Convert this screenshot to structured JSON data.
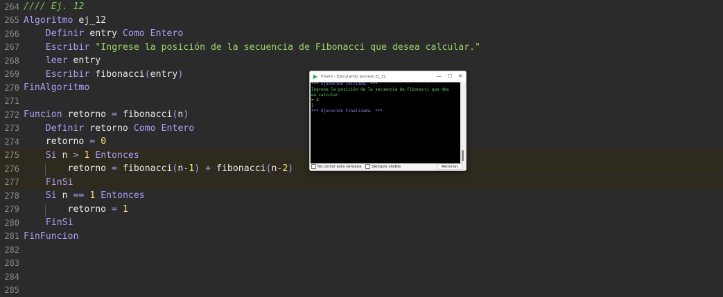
{
  "editor": {
    "lines": [
      {
        "no": "264",
        "tokens": [
          {
            "c": "cm",
            "t": "//// Ej. 12"
          }
        ]
      },
      {
        "no": "265",
        "tokens": [
          {
            "c": "kw",
            "t": "Algoritmo"
          },
          {
            "c": "tx",
            "t": " ej_12"
          }
        ]
      },
      {
        "no": "266",
        "tokens": [
          {
            "c": "tx",
            "t": "    "
          },
          {
            "c": "kw",
            "t": "Definir"
          },
          {
            "c": "tx",
            "t": " entry "
          },
          {
            "c": "kw",
            "t": "Como"
          },
          {
            "c": "tx",
            "t": " "
          },
          {
            "c": "kw",
            "t": "Entero"
          }
        ]
      },
      {
        "no": "267",
        "tokens": [
          {
            "c": "tx",
            "t": "    "
          },
          {
            "c": "kw",
            "t": "Escribir"
          },
          {
            "c": "tx",
            "t": " "
          },
          {
            "c": "st",
            "t": "\"Ingrese la posición de la secuencia de Fibonacci que desea calcular.\""
          }
        ]
      },
      {
        "no": "268",
        "tokens": [
          {
            "c": "tx",
            "t": "    "
          },
          {
            "c": "kw",
            "t": "leer"
          },
          {
            "c": "tx",
            "t": " entry"
          }
        ]
      },
      {
        "no": "269",
        "tokens": [
          {
            "c": "tx",
            "t": "    "
          },
          {
            "c": "kw",
            "t": "Escribir"
          },
          {
            "c": "tx",
            "t": " fibonacci"
          },
          {
            "c": "op",
            "t": "("
          },
          {
            "c": "tx",
            "t": "entry"
          },
          {
            "c": "op",
            "t": ")"
          }
        ]
      },
      {
        "no": "270",
        "tokens": [
          {
            "c": "kw",
            "t": "FinAlgoritmo"
          }
        ]
      },
      {
        "no": "271",
        "tokens": []
      },
      {
        "no": "272",
        "tokens": [
          {
            "c": "kw",
            "t": "Funcion"
          },
          {
            "c": "tx",
            "t": " retorno "
          },
          {
            "c": "op",
            "t": "="
          },
          {
            "c": "tx",
            "t": " fibonacci"
          },
          {
            "c": "op",
            "t": "("
          },
          {
            "c": "tx",
            "t": "n"
          },
          {
            "c": "op",
            "t": ")"
          }
        ]
      },
      {
        "no": "273",
        "tokens": [
          {
            "c": "tx",
            "t": "    "
          },
          {
            "c": "kw",
            "t": "Definir"
          },
          {
            "c": "tx",
            "t": " retorno "
          },
          {
            "c": "kw",
            "t": "Como"
          },
          {
            "c": "tx",
            "t": " "
          },
          {
            "c": "kw",
            "t": "Entero"
          }
        ]
      },
      {
        "no": "274",
        "tokens": [
          {
            "c": "tx",
            "t": "    retorno "
          },
          {
            "c": "op",
            "t": "="
          },
          {
            "c": "tx",
            "t": " "
          },
          {
            "c": "nm",
            "t": "0"
          }
        ]
      },
      {
        "no": "275",
        "hl": true,
        "tokens": [
          {
            "c": "tx",
            "t": "    "
          },
          {
            "c": "kw",
            "t": "Si"
          },
          {
            "c": "tx",
            "t": " n "
          },
          {
            "c": "op",
            "t": ">"
          },
          {
            "c": "tx",
            "t": " "
          },
          {
            "c": "nm",
            "t": "1"
          },
          {
            "c": "tx",
            "t": " "
          },
          {
            "c": "kw",
            "t": "Entonces"
          }
        ]
      },
      {
        "no": "276",
        "hl": true,
        "guide": true,
        "tokens": [
          {
            "c": "tx",
            "t": "        retorno "
          },
          {
            "c": "op",
            "t": "="
          },
          {
            "c": "tx",
            "t": " fibonacci"
          },
          {
            "c": "op",
            "t": "("
          },
          {
            "c": "tx",
            "t": "n"
          },
          {
            "c": "op",
            "t": "-"
          },
          {
            "c": "nm",
            "t": "1"
          },
          {
            "c": "op",
            "t": ")"
          },
          {
            "c": "tx",
            "t": " "
          },
          {
            "c": "op",
            "t": "+"
          },
          {
            "c": "tx",
            "t": " fibonacci"
          },
          {
            "c": "op",
            "t": "("
          },
          {
            "c": "tx",
            "t": "n"
          },
          {
            "c": "op",
            "t": "-"
          },
          {
            "c": "nm",
            "t": "2"
          },
          {
            "c": "op",
            "t": ")"
          }
        ]
      },
      {
        "no": "277",
        "hl": true,
        "tokens": [
          {
            "c": "tx",
            "t": "    "
          },
          {
            "c": "kw",
            "t": "FinSi"
          }
        ]
      },
      {
        "no": "278",
        "tokens": [
          {
            "c": "tx",
            "t": "    "
          },
          {
            "c": "kw",
            "t": "Si"
          },
          {
            "c": "tx",
            "t": " n "
          },
          {
            "c": "op",
            "t": "=="
          },
          {
            "c": "tx",
            "t": " "
          },
          {
            "c": "nm",
            "t": "1"
          },
          {
            "c": "tx",
            "t": " "
          },
          {
            "c": "kw",
            "t": "Entonces"
          }
        ]
      },
      {
        "no": "279",
        "guide": true,
        "tokens": [
          {
            "c": "tx",
            "t": "        retorno "
          },
          {
            "c": "op",
            "t": "="
          },
          {
            "c": "tx",
            "t": " "
          },
          {
            "c": "nm",
            "t": "1"
          }
        ]
      },
      {
        "no": "280",
        "tokens": [
          {
            "c": "tx",
            "t": "    "
          },
          {
            "c": "kw",
            "t": "FinSi"
          }
        ]
      },
      {
        "no": "281",
        "tokens": [
          {
            "c": "kw",
            "t": "FinFuncion"
          }
        ]
      },
      {
        "no": "282",
        "tokens": []
      },
      {
        "no": "283",
        "tokens": []
      },
      {
        "no": "284",
        "tokens": []
      },
      {
        "no": "285",
        "tokens": []
      }
    ]
  },
  "console": {
    "title": "PSeInt - Ejecutando proceso Ej_12",
    "minimize": "—",
    "maximize": "☐",
    "close": "✕",
    "lines": [
      {
        "c": "c-blue",
        "t": "*** Ejecución Iniciada. ***"
      },
      {
        "c": "c-green",
        "t": "Ingrese la posición de la secuencia de Fibonacci que des"
      },
      {
        "c": "c-green",
        "t": "ea calcular."
      },
      {
        "c": "c-yellow",
        "t": "> 2"
      },
      {
        "c": "c-green",
        "t": "1"
      },
      {
        "c": "c-blue",
        "t": "*** Ejecución Finalizada. ***"
      }
    ],
    "footer": {
      "no_close_label": "No cerrar esta ventana",
      "always_visible_label": "Siempre visible",
      "restart_label": "Reiniciar"
    }
  },
  "colors": {
    "editor_bg": "#2b2b2b",
    "keyword": "#b09bf5",
    "comment": "#7ec552",
    "string": "#9ed36a",
    "number": "#f7e36a",
    "highlight_bg": "#2e2a1d"
  }
}
